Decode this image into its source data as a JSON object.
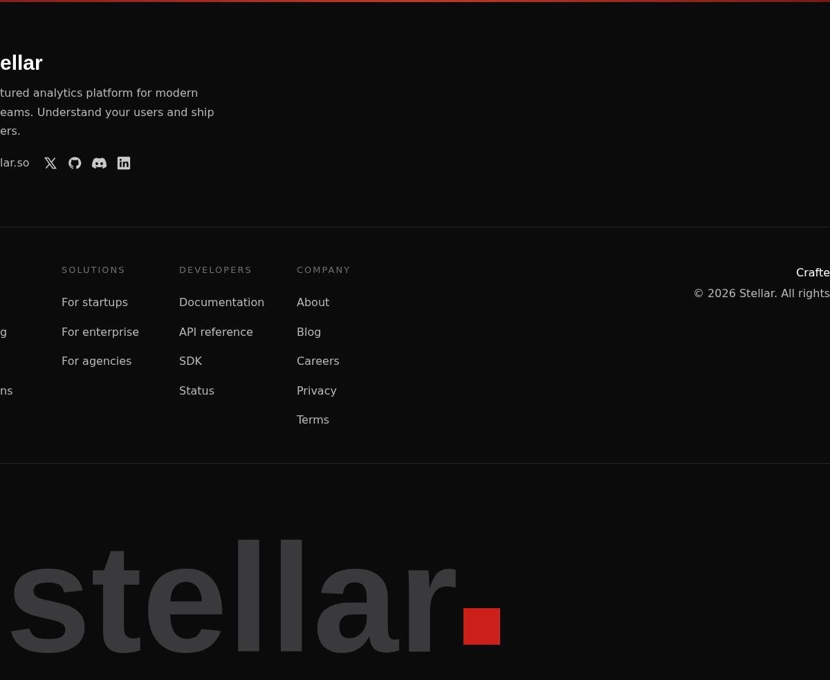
{
  "brand": {
    "name": "ellar",
    "description": [
      "tured analytics platform for modern",
      "eams. Understand your users and ship",
      "ers."
    ],
    "contact": "lar.so",
    "social": [
      {
        "kind": "x"
      },
      {
        "kind": "github"
      },
      {
        "kind": "discord"
      },
      {
        "kind": "linkedin"
      }
    ]
  },
  "columns": [
    {
      "items": [
        "g",
        "ns"
      ]
    },
    {
      "title": "SOLUTIONS",
      "items": [
        "For startups",
        "For enterprise",
        "For agencies"
      ]
    },
    {
      "title": "DEVELOPERS",
      "items": [
        "Documentation",
        "API reference",
        "SDK",
        "Status"
      ]
    },
    {
      "title": "COMPANY",
      "items": [
        "About",
        "Blog",
        "Careers",
        "Privacy",
        "Terms"
      ]
    }
  ],
  "credit": {
    "crafted": "Crafte",
    "copyright": "© 2026 Stellar. All rights"
  },
  "wordmark": "stellar"
}
